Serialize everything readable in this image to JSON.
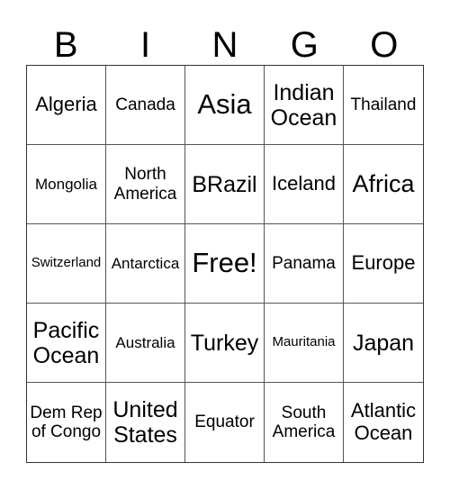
{
  "header": {
    "letters": [
      "B",
      "I",
      "N",
      "G",
      "O"
    ]
  },
  "card": {
    "cells": [
      "Algeria",
      "Canada",
      "Asia",
      "Indian Ocean",
      "Thailand",
      "Mongolia",
      "North America",
      "BRazil",
      "Iceland",
      "Africa",
      "Switzerland",
      "Antarctica",
      "Free!",
      "Panama",
      "Europe",
      "Pacific Ocean",
      "Australia",
      "Turkey",
      "Mauritania",
      "Japan",
      "Dem Rep of Congo",
      "United States",
      "Equator",
      "South America",
      "Atlantic Ocean"
    ]
  }
}
